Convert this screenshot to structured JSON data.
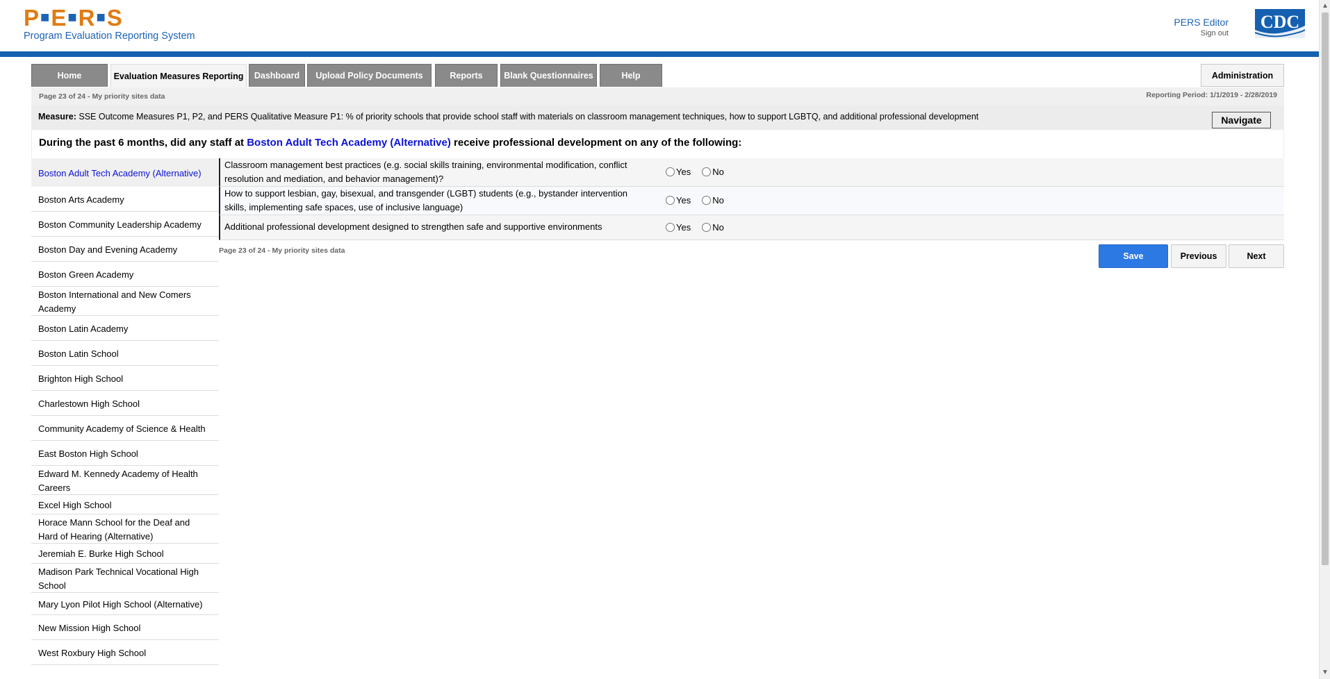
{
  "header": {
    "logo_letters": [
      "P",
      "E",
      "R",
      "S"
    ],
    "logo_subtitle": "Program Evaluation Reporting System",
    "user_name": "PERS Editor",
    "sign_out": "Sign out",
    "cdc_logo_text": "CDC"
  },
  "tabs": [
    {
      "label": "Home",
      "active": false
    },
    {
      "label": "Evaluation Measures Reporting",
      "active": true
    },
    {
      "label": "Dashboard",
      "active": false
    },
    {
      "label": "Upload Policy Documents",
      "active": false
    },
    {
      "label": "Reports",
      "active": false
    },
    {
      "label": "Blank Questionnaires",
      "active": false
    },
    {
      "label": "Help",
      "active": false
    }
  ],
  "administration_label": "Administration",
  "page_info": "Page 23 of 24 - My priority sites data",
  "reporting_period": "Reporting Period: 1/1/2019 - 2/28/2019",
  "measure": {
    "label": "Measure:",
    "text": "SSE Outcome Measures P1, P2, and PERS Qualitative Measure P1: % of priority schools that provide school staff with materials on classroom management techniques, how to support LGBTQ, and additional professional development"
  },
  "navigate_label": "Navigate",
  "question": {
    "prefix": "During the past 6 months, did any staff at",
    "school": "Boston Adult Tech Academy (Alternative)",
    "suffix": "receive professional development on any of the following:"
  },
  "schools": [
    "Boston Adult Tech Academy (Alternative)",
    "Boston Arts Academy",
    "Boston Community Leadership Academy",
    "Boston Day and Evening Academy",
    "Boston Green Academy",
    "Boston International and New Comers Academy",
    "Boston Latin Academy",
    "Boston Latin School",
    "Brighton High School",
    "Charlestown High School",
    "Community Academy of Science & Health",
    "East Boston High School",
    "Edward M. Kennedy Academy of Health Careers",
    "Excel High School",
    "Horace Mann School for the Deaf and Hard of Hearing (Alternative)",
    "Jeremiah E. Burke High School",
    "Madison Park Technical Vocational High School",
    "Mary Lyon Pilot High School (Alternative)",
    "New Mission High School",
    "West Roxbury High School"
  ],
  "selected_school_index": 0,
  "items": [
    {
      "text": "Classroom management best practices (e.g. social skills training, environmental modification, conflict resolution and mediation, and behavior management)?",
      "yes": "Yes",
      "no": "No"
    },
    {
      "text": "How to support lesbian, gay, bisexual, and transgender (LGBT) students (e.g., bystander intervention skills, implementing safe spaces, use of inclusive language)",
      "yes": "Yes",
      "no": "No"
    },
    {
      "text": "Additional professional development designed to strengthen safe and supportive environments",
      "yes": "Yes",
      "no": "No"
    }
  ],
  "buttons": {
    "save": "Save",
    "previous": "Previous",
    "next": "Next"
  },
  "colors": {
    "accent_blue": "#1560b0",
    "logo_orange": "#e07b12",
    "selected_school": "#0c12d6",
    "save_button": "#2d79e3"
  }
}
